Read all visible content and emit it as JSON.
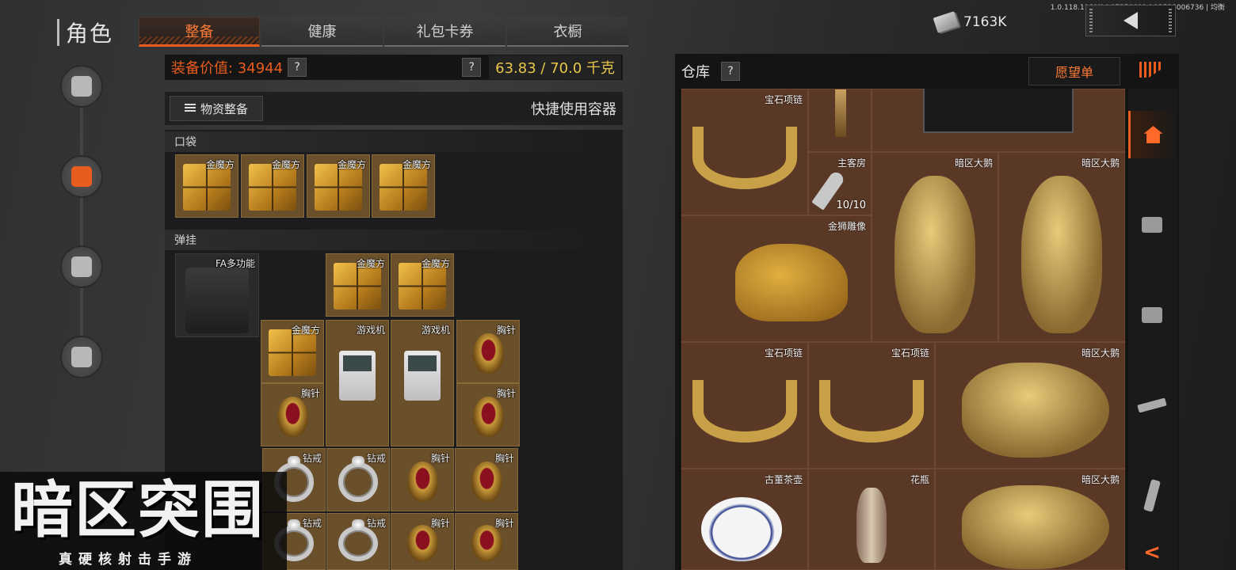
{
  "version": "1.0.118.118(4) | 07250011 | 12528006736 | 均衡",
  "header": {
    "title": "角色",
    "tabs": [
      {
        "label": "整备",
        "active": true
      },
      {
        "label": "健康",
        "active": false
      },
      {
        "label": "礼包卡券",
        "active": false
      },
      {
        "label": "衣橱",
        "active": false
      }
    ],
    "money": "7163K"
  },
  "side_nav": [
    {
      "icon": "helmet-gun-icon",
      "active": false
    },
    {
      "icon": "backpack-loadout-icon",
      "active": true
    },
    {
      "icon": "bag-icon",
      "active": false
    },
    {
      "icon": "tools-icon",
      "active": false
    }
  ],
  "equipment": {
    "value_label": "装备价值: 34944",
    "help": "?",
    "weight": "63.83 / 70.0 千克",
    "resupply_button": "物资整备",
    "quick_container": "快捷使用容器",
    "pocket_label": "口袋",
    "rig_label": "弹挂"
  },
  "pocket_items": [
    {
      "name": "金魔方",
      "type": "gold-cube"
    },
    {
      "name": "金魔方",
      "type": "gold-cube"
    },
    {
      "name": "金魔方",
      "type": "gold-cube"
    },
    {
      "name": "金魔方",
      "type": "gold-cube"
    }
  ],
  "rig": {
    "name": "FA多功能"
  },
  "rig_items": [
    {
      "name": "金魔方",
      "type": "gold-cube"
    },
    {
      "name": "金魔方",
      "type": "gold-cube"
    },
    {
      "name": "金魔方",
      "type": "gold-cube"
    },
    {
      "name": "游戏机",
      "type": "game-machine"
    },
    {
      "name": "游戏机",
      "type": "game-machine"
    },
    {
      "name": "胸针",
      "type": "brooch"
    },
    {
      "name": "胸针",
      "type": "brooch"
    },
    {
      "name": "胸针",
      "type": "brooch"
    },
    {
      "name": "钻戒",
      "type": "ring"
    },
    {
      "name": "钻戒",
      "type": "ring"
    },
    {
      "name": "胸针",
      "type": "brooch"
    },
    {
      "name": "胸针",
      "type": "brooch"
    },
    {
      "name": "钻戒",
      "type": "ring"
    },
    {
      "name": "钻戒",
      "type": "ring"
    },
    {
      "name": "胸针",
      "type": "brooch"
    },
    {
      "name": "胸针",
      "type": "brooch"
    }
  ],
  "warehouse": {
    "title": "仓库",
    "help": "?",
    "wishlist": "愿望单",
    "items": [
      {
        "name": "宝石项链",
        "type": "necklace"
      },
      {
        "name": "",
        "type": "candle"
      },
      {
        "name": "",
        "type": "case"
      },
      {
        "name": "主客房",
        "type": "key",
        "count": "10/10"
      },
      {
        "name": "暗区大鹅",
        "type": "penguin"
      },
      {
        "name": "暗区大鹅",
        "type": "penguin"
      },
      {
        "name": "金狮雕像",
        "type": "lion"
      },
      {
        "name": "宝石项链",
        "type": "necklace"
      },
      {
        "name": "宝石项链",
        "type": "necklace"
      },
      {
        "name": "暗区大鹅",
        "type": "penguin"
      },
      {
        "name": "古董茶壶",
        "type": "teapot"
      },
      {
        "name": "花瓶",
        "type": "vase"
      },
      {
        "name": "暗区大鹅",
        "type": "penguin"
      }
    ]
  },
  "rail": [
    {
      "icon": "home-icon",
      "active": true
    },
    {
      "icon": "storage-box-icon",
      "active": false
    },
    {
      "icon": "storage-box-icon",
      "active": false
    },
    {
      "icon": "rifle-icon",
      "active": false
    },
    {
      "icon": "magazine-icon",
      "active": false
    }
  ],
  "logo": {
    "big": "暗区突围",
    "small": "真硬核射击手游"
  },
  "colors": {
    "accent": "#e85d1d",
    "gold": "#e8c64a",
    "warehouse_bg": "#4a2d1e"
  }
}
